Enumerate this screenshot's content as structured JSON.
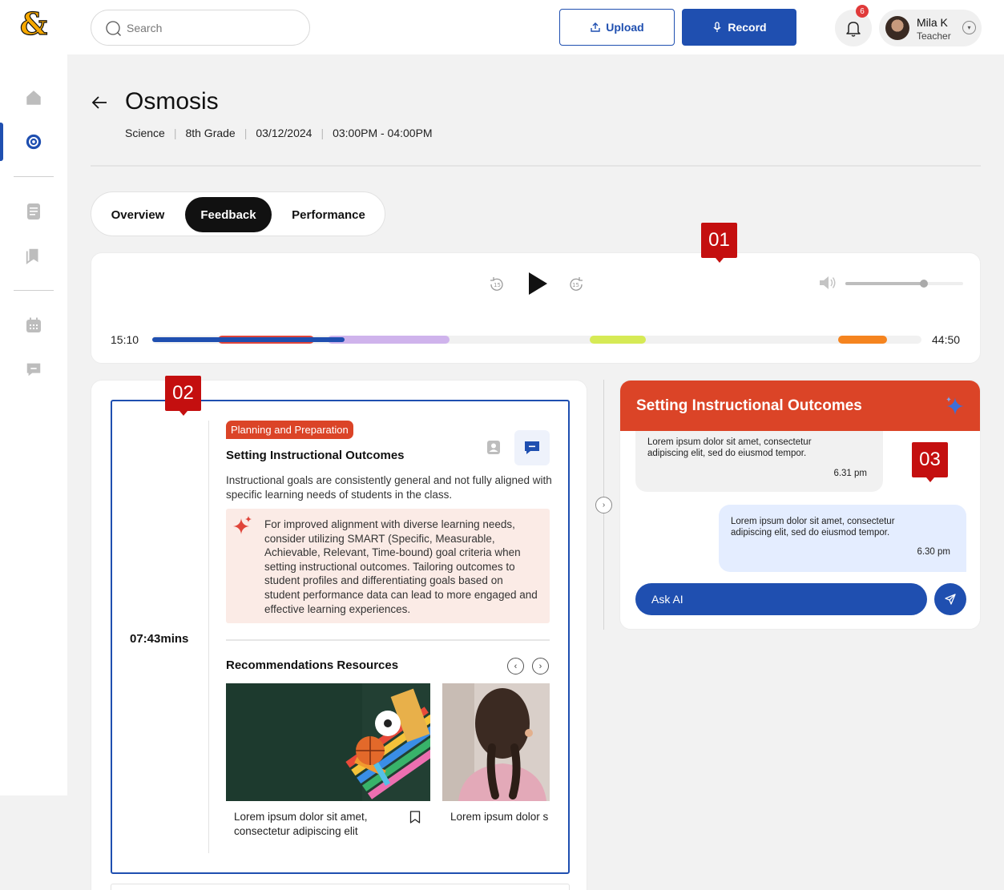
{
  "topbar": {
    "search_placeholder": "Search",
    "upload_label": "Upload",
    "record_label": "Record",
    "notification_count": "6",
    "user": {
      "name": "Mila K",
      "role": "Teacher"
    }
  },
  "page": {
    "title": "Osmosis",
    "meta": [
      "Science",
      "8th Grade",
      "03/12/2024",
      "03:00PM - 04:00PM"
    ]
  },
  "tabs": [
    {
      "label": "Overview",
      "active": false
    },
    {
      "label": "Feedback",
      "active": true
    },
    {
      "label": "Performance",
      "active": false
    }
  ],
  "player": {
    "current_time": "15:10",
    "end_time": "44:50",
    "volume_level": 0.67,
    "progress": 0.25,
    "segment_colors": [
      "#e0453a",
      "#cfb3ec",
      "#d6ea55",
      "#f5841f"
    ],
    "progress_color": "#1f4fb0"
  },
  "markers": [
    "01",
    "02",
    "03"
  ],
  "feedback": {
    "timestamp": "07:43mins",
    "category": "Planning and Preparation",
    "title": "Setting Instructional Outcomes",
    "description": "Instructional goals are consistently general and not fully aligned with specific learning needs of students in the class.",
    "ai_suggestion": "For improved alignment with diverse learning needs, consider utilizing SMART (Specific, Measurable, Achievable, Relevant, Time-bound) goal criteria when setting instructional outcomes. Tailoring outcomes to student profiles and differentiating goals based on student performance data can lead to more engaged and effective learning experiences.",
    "recommendations_title": "Recommendations Resources",
    "resources": [
      {
        "line1": "Lorem ipsum dolor sit amet,",
        "line2": "consectetur adipiscing elit"
      },
      {
        "line1": "Lorem ipsum dolor s",
        "line2": ""
      }
    ]
  },
  "chat": {
    "title": "Setting Instructional Outcomes",
    "messages": [
      {
        "text": "Lorem ipsum dolor sit amet, consectetur adipiscing elit, sed do eiusmod tempor.",
        "time": "6.31 pm"
      },
      {
        "text": "Lorem ipsum dolor sit amet, consectetur adipiscing elit, sed do eiusmod tempor.",
        "time": "6.30 pm"
      }
    ],
    "input_placeholder": "Ask AI"
  },
  "colors": {
    "brand_blue": "#1f4fb0",
    "accent_orange": "#db4427",
    "marker_red": "#c40f0f"
  }
}
